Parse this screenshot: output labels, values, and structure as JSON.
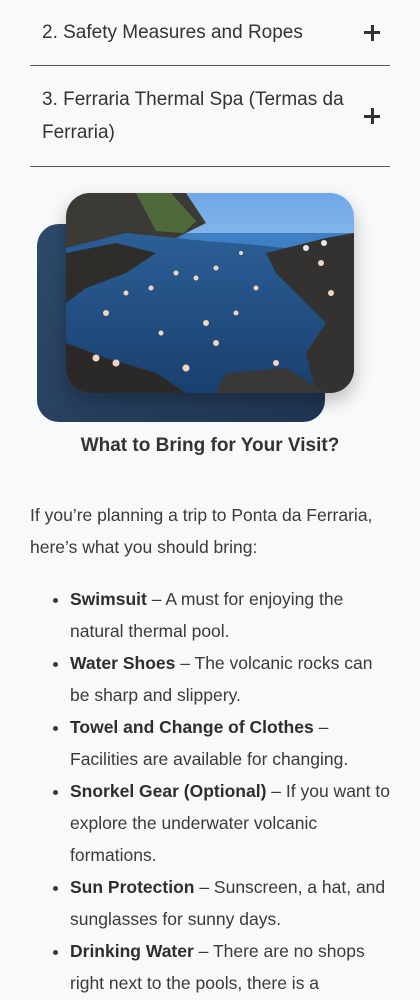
{
  "accordion": [
    {
      "label": "2. Safety Measures and Ropes"
    },
    {
      "label": "3. Ferraria Thermal Spa (Termas da Ferraria)"
    }
  ],
  "image": {
    "alt": "Swimmers in the natural ocean thermal pool at Ponta da Ferraria"
  },
  "section": {
    "title": "What to Bring for Your Visit?",
    "intro": "If you’re planning a trip to Ponta da Ferraria, here’s what you should bring:"
  },
  "items": [
    {
      "title": "Swimsuit",
      "text": " – A must for enjoying the natural thermal pool."
    },
    {
      "title": "Water Shoes",
      "text": " – The volcanic rocks can be sharp and slippery."
    },
    {
      "title": "Towel and Change of Clothes",
      "text": " – Facilities are available for changing."
    },
    {
      "title": "Snorkel Gear (Optional)",
      "text": " – If you want to explore the underwater volcanic formations."
    },
    {
      "title": "Sun Protection",
      "text": " – Sunscreen, a hat, and sunglasses for sunny days."
    },
    {
      "title": "Drinking Water",
      "text": " – There are no shops right next to the pools, there is a"
    }
  ],
  "colors": {
    "background": "#f8f9fa",
    "text": "#3a3a3a",
    "divider": "#555555",
    "backdrop": "#2e4a6b"
  },
  "icons": {
    "expand": "plus-icon"
  }
}
